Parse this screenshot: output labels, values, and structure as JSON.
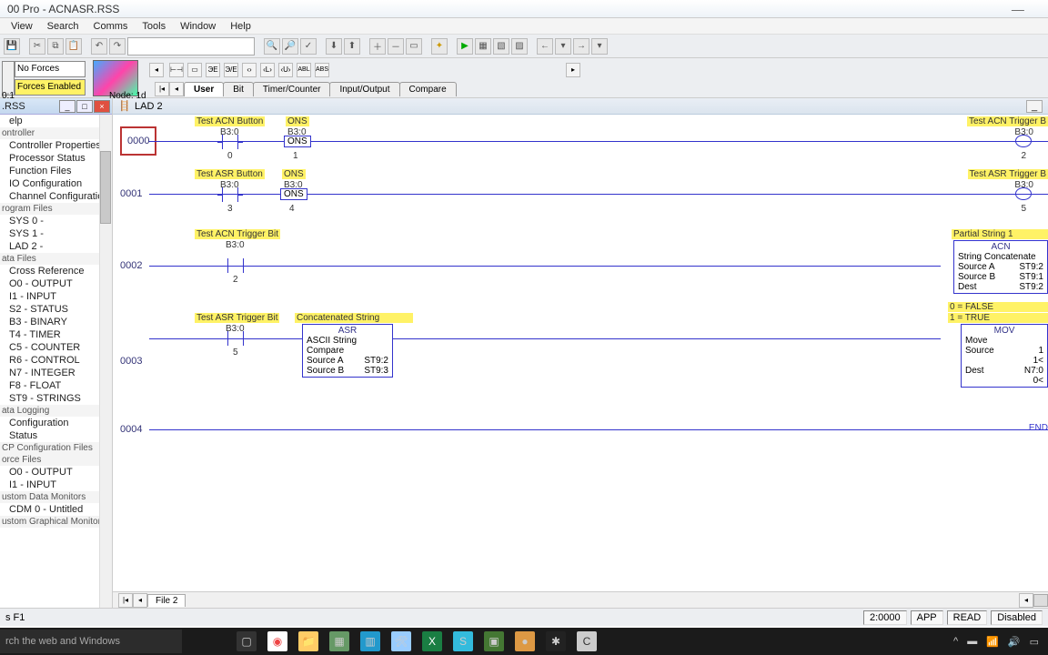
{
  "title": "00 Pro - ACNASR.RSS",
  "menus": [
    "View",
    "Search",
    "Comms",
    "Tools",
    "Window",
    "Help"
  ],
  "forces": {
    "none": "No Forces",
    "enabled": "Forces Enabled",
    "node": "0:1",
    "nodelbl": "Node: 1d"
  },
  "element_tabs": [
    "User",
    "Bit",
    "Timer/Counter",
    "Input/Output",
    "Compare"
  ],
  "left_header": ".RSS",
  "tree": {
    "items_top": [
      "elp",
      "ontroller"
    ],
    "ctrl": [
      "Controller Properties",
      "Processor Status",
      "Function Files",
      "IO Configuration",
      "Channel Configuration"
    ],
    "prog_hdr": "rogram Files",
    "prog": [
      "SYS 0 -",
      "SYS 1 -",
      "LAD 2 -"
    ],
    "data_hdr": "ata Files",
    "data": [
      "Cross Reference",
      "O0 - OUTPUT",
      "I1 - INPUT",
      "S2 - STATUS",
      "B3 - BINARY",
      "T4 - TIMER",
      "C5 - COUNTER",
      "R6 - CONTROL",
      "N7 - INTEGER",
      "F8 - FLOAT",
      "ST9 - STRINGS"
    ],
    "log_hdr": "ata Logging",
    "log": [
      "Configuration",
      "Status"
    ],
    "cfg_hdr": "CP Configuration Files",
    "force_hdr": "orce Files",
    "force": [
      "O0 - OUTPUT",
      "I1 - INPUT"
    ],
    "cdm_hdr": "ustom Data Monitors",
    "cdm": [
      "CDM 0 - Untitled"
    ],
    "cgm_hdr": "ustom Graphical Monitors"
  },
  "lad_title": "LAD 2",
  "rungs": {
    "r0": {
      "num": "0000",
      "tag1": "Test ACN Button",
      "addr1": "B3:0",
      "n1": "0",
      "tag2": "ONS",
      "addr2": "B3:0",
      "ons": "ONS",
      "n2": "1",
      "tagR": "Test ACN Trigger B",
      "addrR": "B3:0",
      "nR": "2"
    },
    "r1": {
      "num": "0001",
      "tag1": "Test ASR Button",
      "addr1": "B3:0",
      "n1": "3",
      "tag2": "ONS",
      "addr2": "B3:0",
      "ons": "ONS",
      "n2": "4",
      "tagR": "Test ASR Trigger B",
      "addrR": "B3:0",
      "nR": "5"
    },
    "r2": {
      "num": "0002",
      "tag1": "Test ACN Trigger Bit",
      "addr1": "B3:0",
      "n1": "2",
      "blk_title": "Partial String 1",
      "blk_sub": "ACN",
      "blk_name": "String Concatenate",
      "rows": [
        [
          "Source A",
          "ST9:2"
        ],
        [
          "Source B",
          "ST9:1"
        ],
        [
          "Dest",
          "ST9:2"
        ]
      ]
    },
    "r3": {
      "num": "0003",
      "tag1": "Test ASR Trigger Bit",
      "addr1": "B3:0",
      "n1": "5",
      "tag2": "Concatenated String",
      "cmp_hdr": "ASR",
      "cmp_name": "ASCII String Compare",
      "cmp_rows": [
        [
          "Source A",
          "ST9:2"
        ],
        [
          "Source B",
          "ST9:3"
        ]
      ],
      "note1": "0 = FALSE",
      "note2": "1 = TRUE",
      "mov_hdr": "MOV",
      "mov_name": "Move",
      "mov_rows": [
        [
          "Source",
          "1"
        ],
        [
          "",
          "1<"
        ],
        [
          "Dest",
          "N7:0"
        ],
        [
          "",
          "0<"
        ]
      ]
    },
    "r4": {
      "num": "0004",
      "end": "END"
    }
  },
  "file_tab": "File 2",
  "status": {
    "help": "s F1",
    "pos": "2:0000",
    "mode": "APP",
    "read": "READ",
    "dis": "Disabled"
  },
  "search_placeholder": "rch the web and Windows"
}
